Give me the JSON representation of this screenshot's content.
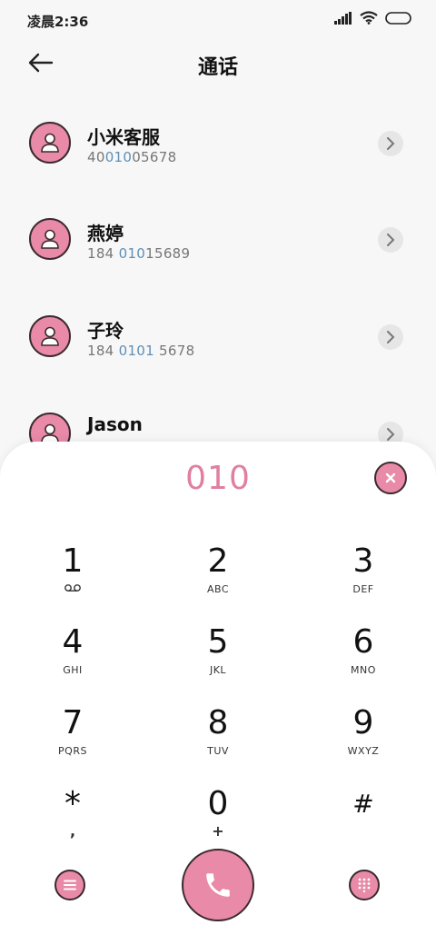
{
  "status_bar": {
    "time": "凌晨2:36"
  },
  "header": {
    "title": "通话"
  },
  "contacts": [
    {
      "name": "小米客服",
      "number_pre": "40",
      "number_hl": "010",
      "number_post": "05678"
    },
    {
      "name": "燕婷",
      "number_pre": "184 ",
      "number_hl": "010",
      "number_post": "15689"
    },
    {
      "name": "子玲",
      "number_pre": "184 ",
      "number_hl": "0101",
      "number_post": " 5678"
    },
    {
      "name": "Jason",
      "number_pre": "",
      "number_hl": "",
      "number_post": ""
    }
  ],
  "dialer": {
    "input": "010",
    "keys": [
      {
        "digit": "1",
        "letters": ""
      },
      {
        "digit": "2",
        "letters": "ABC"
      },
      {
        "digit": "3",
        "letters": "DEF"
      },
      {
        "digit": "4",
        "letters": "GHI"
      },
      {
        "digit": "5",
        "letters": "JKL"
      },
      {
        "digit": "6",
        "letters": "MNO"
      },
      {
        "digit": "7",
        "letters": "PQRS"
      },
      {
        "digit": "8",
        "letters": "TUV"
      },
      {
        "digit": "9",
        "letters": "WXYZ"
      },
      {
        "digit": "*",
        "letters": ","
      },
      {
        "digit": "0",
        "letters": "+"
      },
      {
        "digit": "#",
        "letters": ""
      }
    ]
  },
  "colors": {
    "accent": "#e88aa8",
    "accent_text": "#e07fa1",
    "highlight": "#5e8fb8",
    "outline": "#3a2a2e"
  }
}
